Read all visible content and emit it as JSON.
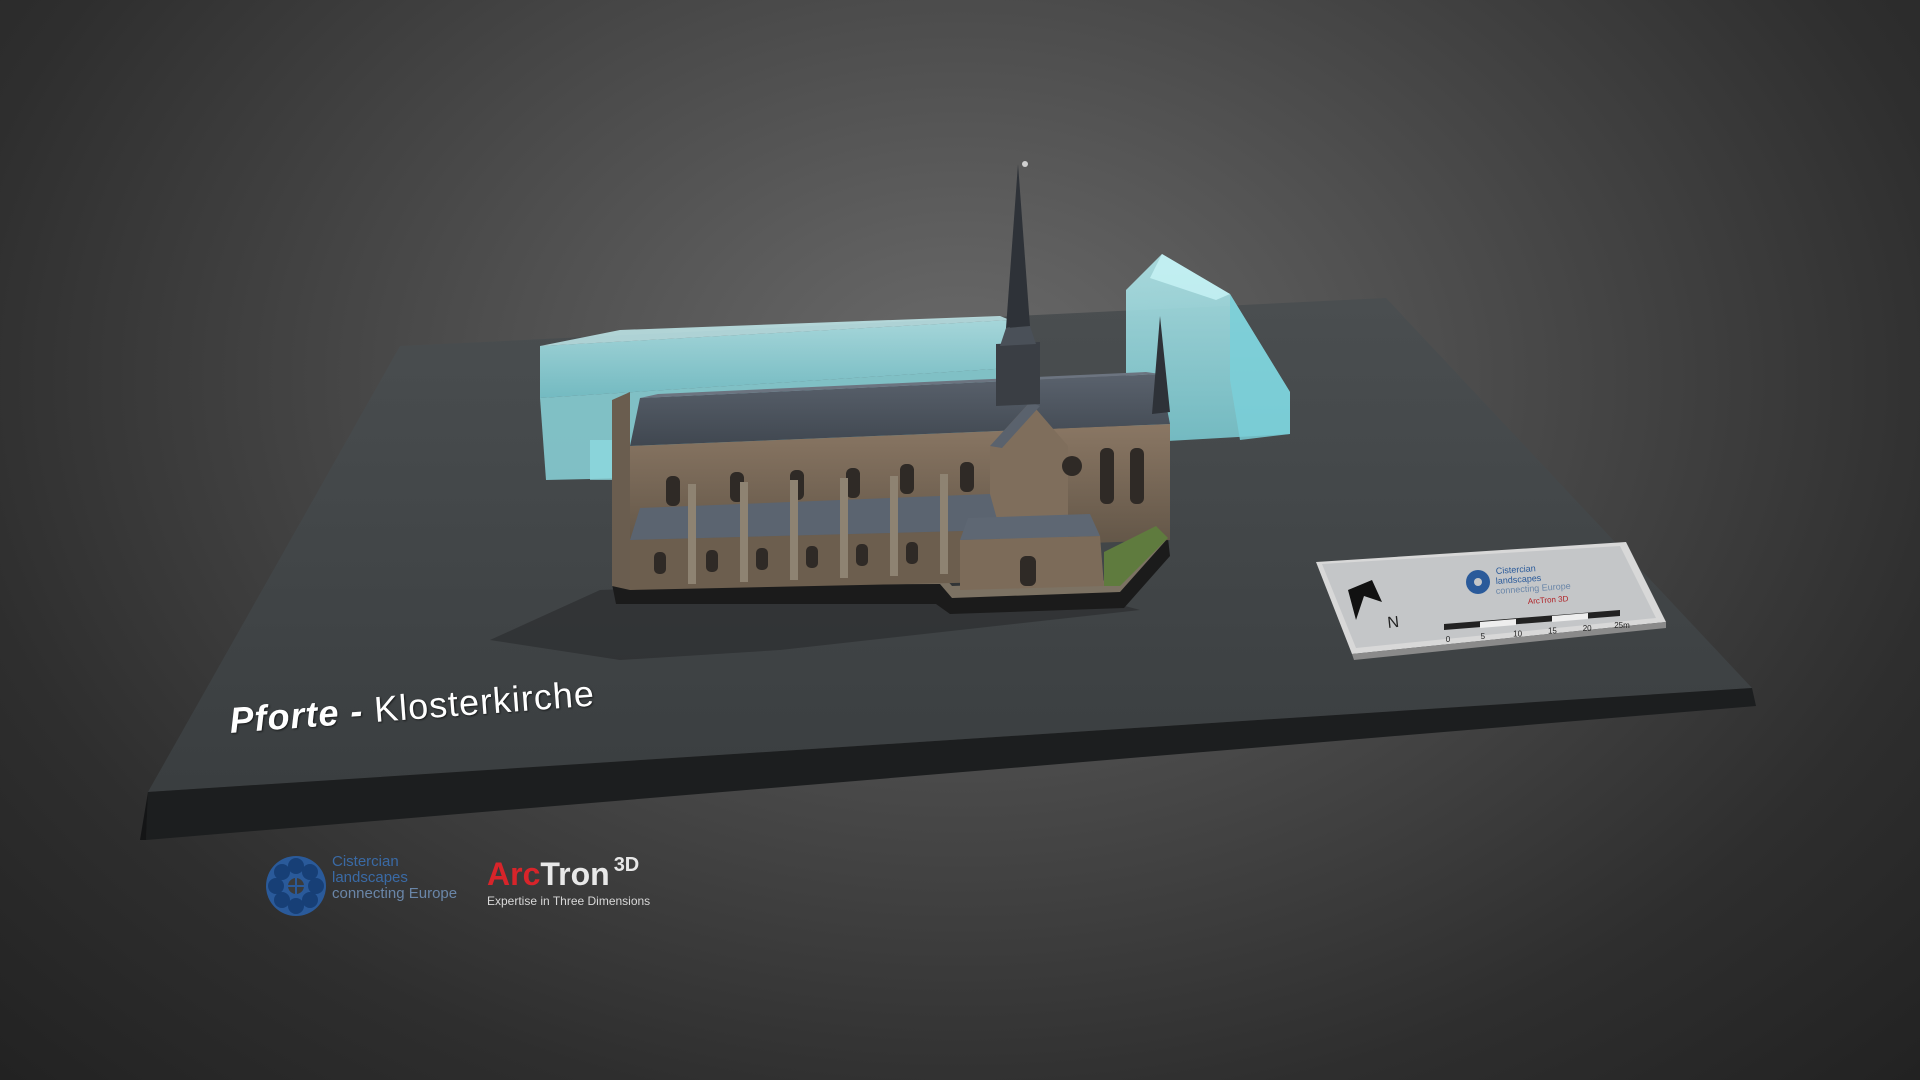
{
  "model_title": {
    "place": "Pforte",
    "separator": " - ",
    "subject": "Klosterkirche"
  },
  "logos": {
    "cistercian": {
      "line1": "Cistercian",
      "line2": "landscapes",
      "line3": "connecting Europe"
    },
    "arctron": {
      "prefix": "Arc",
      "suffix": "Tron",
      "superscript": "3D",
      "tagline": "Expertise in Three Dimensions"
    }
  },
  "plaque": {
    "north": "N",
    "scale_ticks": [
      "0",
      "5",
      "10",
      "15",
      "20",
      "25m"
    ],
    "logo_line1": "Cistercian",
    "logo_line2": "landscapes",
    "logo_line3": "connecting Europe",
    "logo_brand": "ArcTron 3D"
  },
  "colors": {
    "glass": "#9fe6ec",
    "board": "#3b3f41",
    "roof": "#4e5661",
    "stone": "#7b6a58",
    "brand_red": "#d8242a",
    "brand_blue": "#2a5a9a"
  }
}
